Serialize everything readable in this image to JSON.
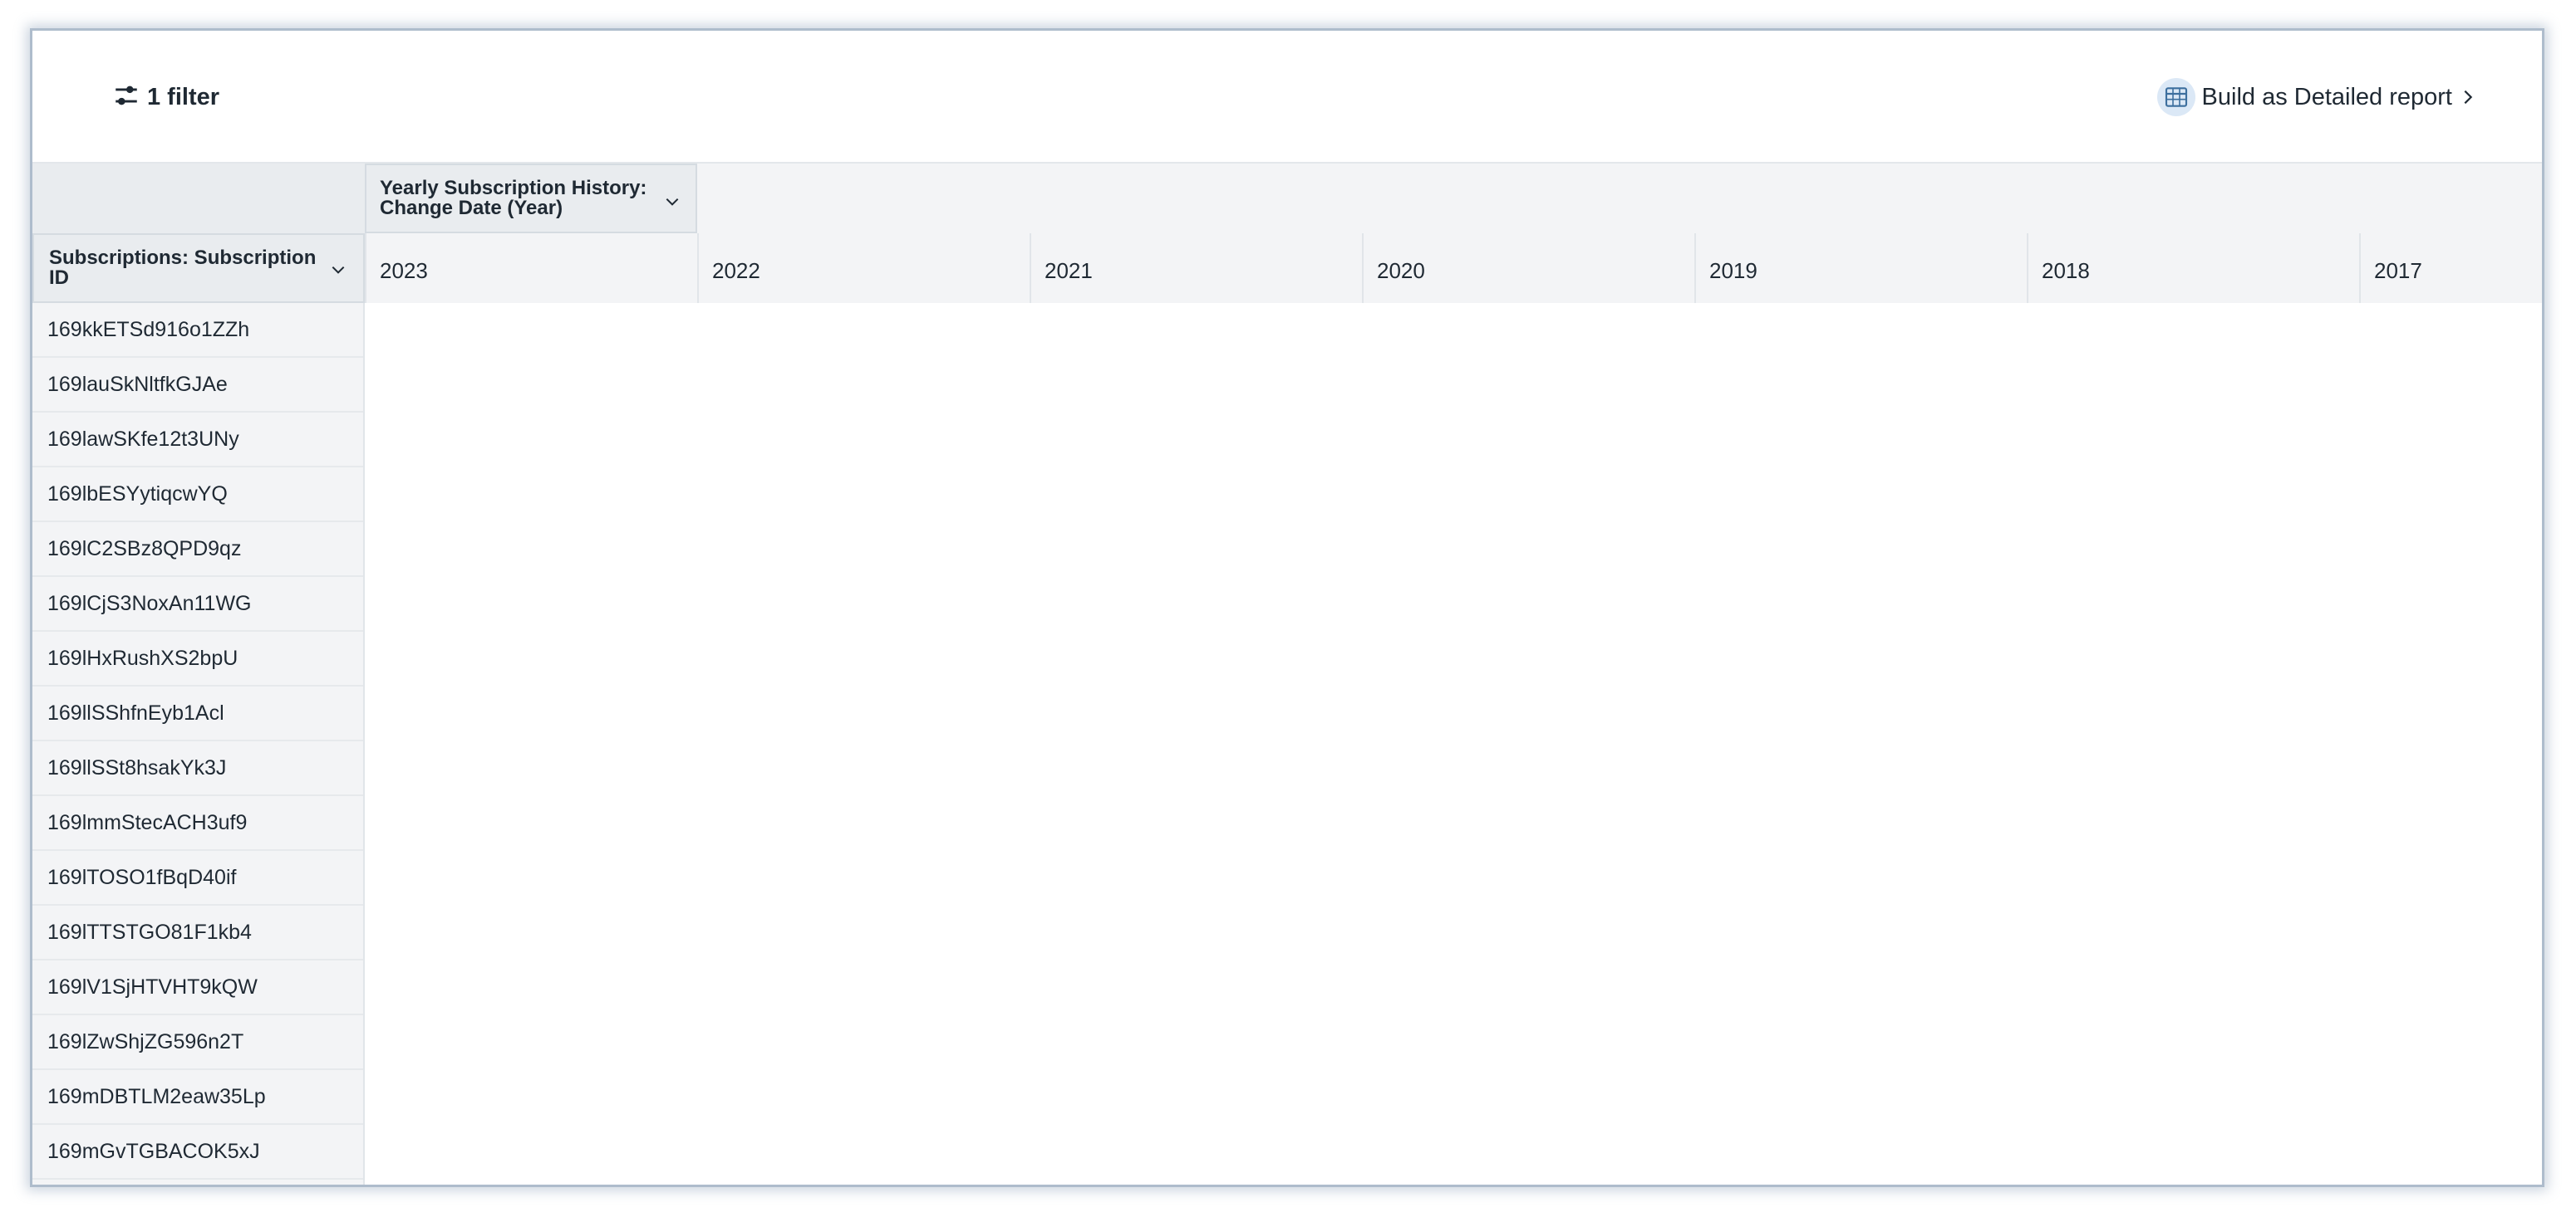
{
  "toolbar": {
    "filter_label": "1 filter",
    "filter_icon": "sliders-icon",
    "build_label": "Build as Detailed report",
    "build_icon": "table-report-icon"
  },
  "pivot": {
    "column_field": "Yearly Subscription History: Change Date (Year)",
    "row_field": "Subscriptions: Subscription ID",
    "columns": [
      "2023",
      "2022",
      "2021",
      "2020",
      "2019",
      "2018",
      "2017"
    ],
    "rows": [
      "169kkETSd916o1ZZh",
      "169lauSkNltfkGJAe",
      "169lawSKfe12t3UNy",
      "169lbESYytiqcwYQ",
      "169lC2SBz8QPD9qz",
      "169lCjS3NoxAn11WG",
      "169lHxRushXS2bpU",
      "169llSShfnEyb1Acl",
      "169llSSt8hsakYk3J",
      "169lmmStecACH3uf9",
      "169lTOSO1fBqD40if",
      "169lTTSTGO81F1kb4",
      "169lV1SjHTVHT9kQW",
      "169lZwShjZG596n2T",
      "169mDBTLM2eaw35Lp",
      "169mGvTGBACOK5xJ"
    ]
  },
  "colors": {
    "header_bg": "#f3f4f6",
    "field_chip_bg": "#e9ecef",
    "panel_border": "#aebccc"
  }
}
